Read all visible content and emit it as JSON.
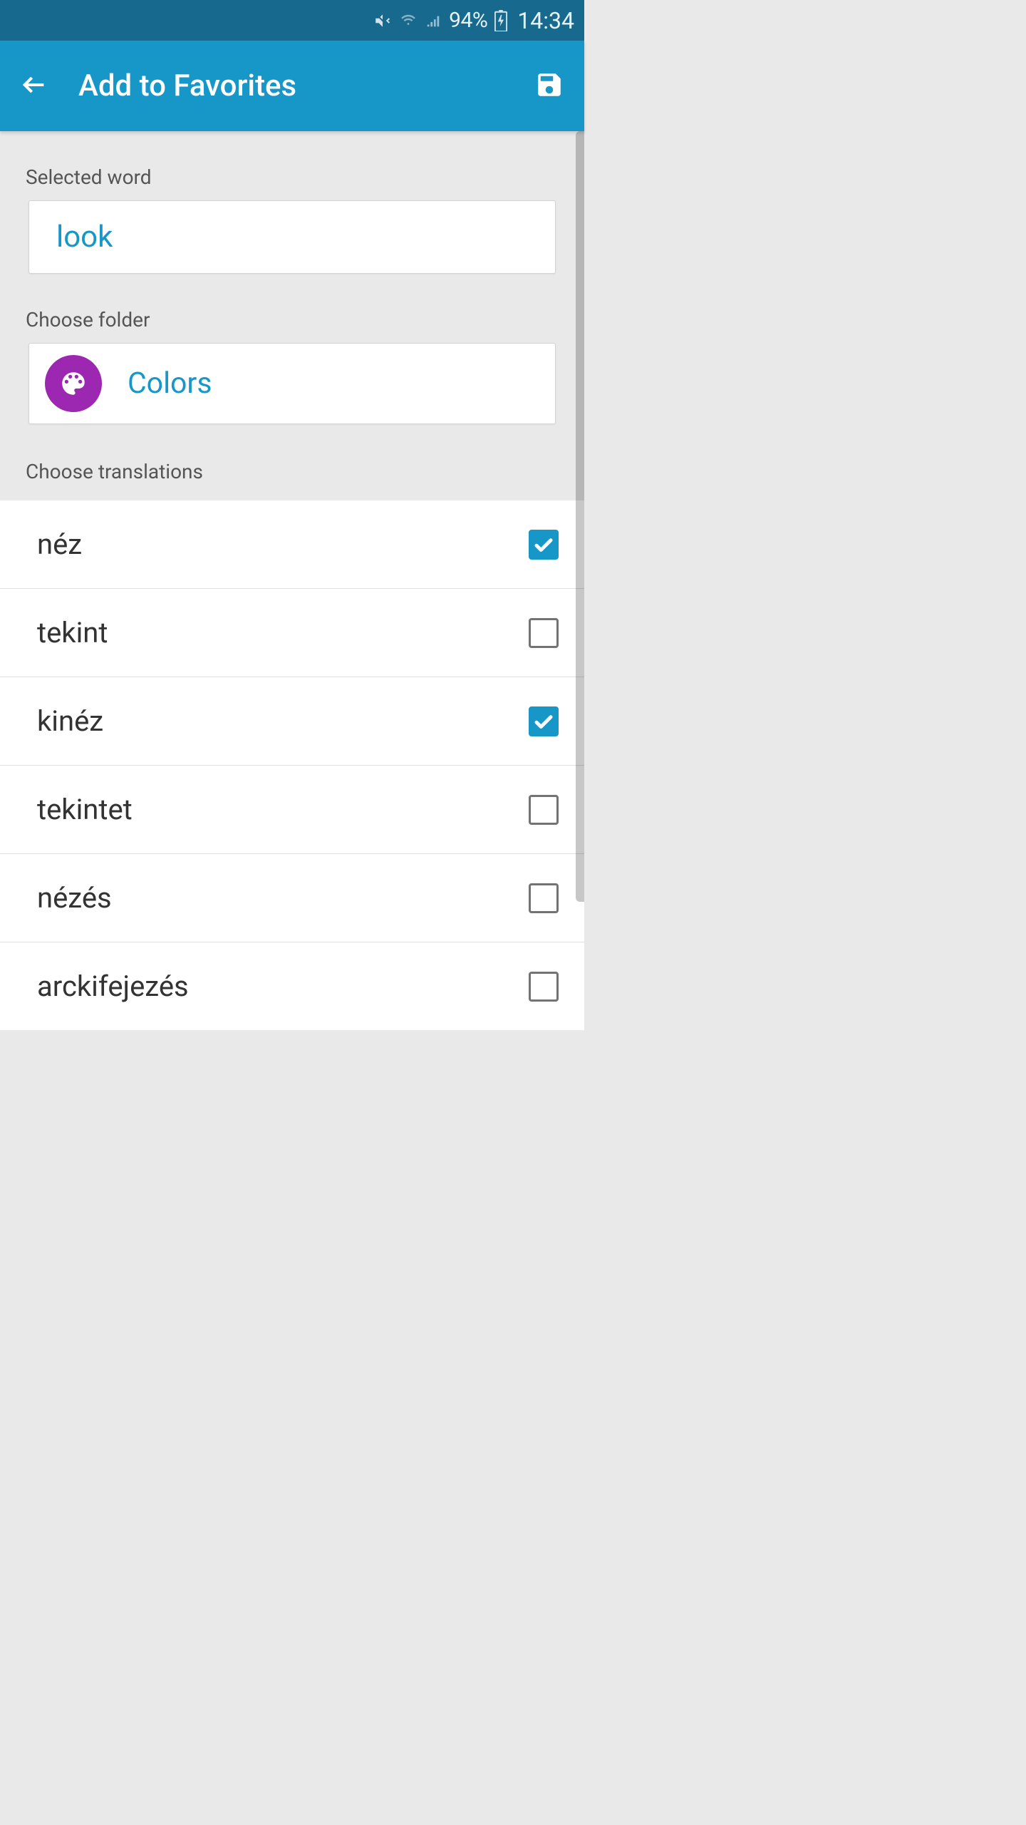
{
  "status": {
    "battery": "94%",
    "time": "14:34"
  },
  "appbar": {
    "title": "Add to Favorites"
  },
  "labels": {
    "selected_word": "Selected word",
    "choose_folder": "Choose folder",
    "choose_translations": "Choose translations"
  },
  "selected_word": "look",
  "folder": {
    "name": "Colors",
    "icon": "palette-icon",
    "color": "#9c27b0"
  },
  "translations": [
    {
      "label": "néz",
      "checked": true
    },
    {
      "label": "tekint",
      "checked": false
    },
    {
      "label": "kinéz",
      "checked": true
    },
    {
      "label": "tekintet",
      "checked": false
    },
    {
      "label": "nézés",
      "checked": false
    },
    {
      "label": "arckifejezés",
      "checked": false
    }
  ],
  "colors": {
    "accent": "#1797c7",
    "status_bar": "#176a8e",
    "folder_badge": "#9c27b0"
  }
}
